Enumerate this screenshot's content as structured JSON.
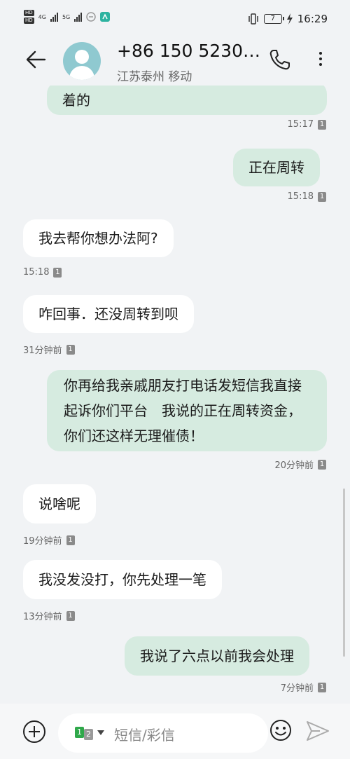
{
  "status": {
    "left_tags": [
      "HD",
      "HD",
      "4G",
      "5G"
    ],
    "time": "16:29",
    "battery": "7"
  },
  "header": {
    "contact": "+86 150 5230…",
    "location": "江苏泰州 移动"
  },
  "messages": [
    {
      "side": "out",
      "text": "着的",
      "time": "15:17"
    },
    {
      "side": "out",
      "text": "正在周转",
      "time": "15:18"
    },
    {
      "side": "in",
      "text": "我去帮你想办法阿?",
      "time": "15:18"
    },
    {
      "side": "in",
      "text": "咋回事．还没周转到呗",
      "time": "31分钟前"
    },
    {
      "side": "out",
      "text": "你再给我亲戚朋友打电话发短信我直接起诉你们平台　我说的正在周转资金，你们还这样无理催债！",
      "time": "20分钟前"
    },
    {
      "side": "in",
      "text": "说啥呢",
      "time": "19分钟前"
    },
    {
      "side": "in",
      "text": "我没发没打，你先处理一笔",
      "time": "13分钟前"
    },
    {
      "side": "out",
      "text": "我说了六点以前我会处理",
      "time": "7分钟前"
    }
  ],
  "sim_badge": "1",
  "composer": {
    "placeholder": "短信/彩信",
    "sim1": "1",
    "sim2": "2"
  }
}
